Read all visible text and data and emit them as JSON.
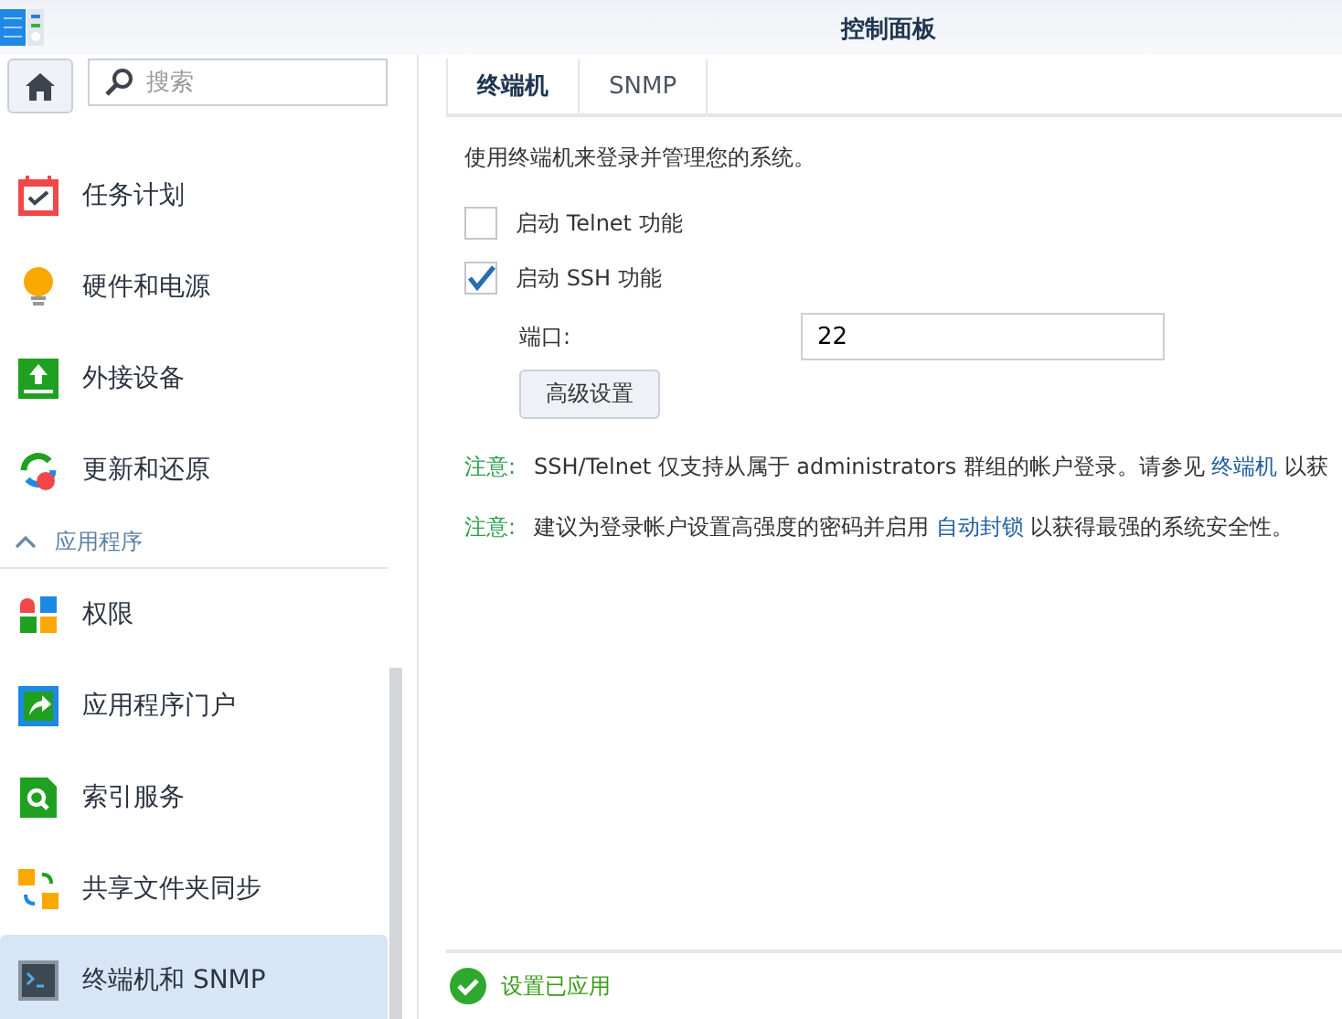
{
  "window": {
    "title": "控制面板"
  },
  "search": {
    "placeholder": "搜索"
  },
  "sidebar": {
    "items": [
      {
        "kind": "item",
        "label": "任务计划",
        "selected": false
      },
      {
        "kind": "item",
        "label": "硬件和电源",
        "selected": false
      },
      {
        "kind": "item",
        "label": "外接设备",
        "selected": false
      },
      {
        "kind": "item",
        "label": "更新和还原",
        "selected": false
      },
      {
        "kind": "section",
        "label": "应用程序",
        "expanded": true
      },
      {
        "kind": "item",
        "label": "权限",
        "selected": false
      },
      {
        "kind": "item",
        "label": "应用程序门户",
        "selected": false
      },
      {
        "kind": "item",
        "label": "索引服务",
        "selected": false
      },
      {
        "kind": "item",
        "label": "共享文件夹同步",
        "selected": false
      },
      {
        "kind": "item",
        "label": "终端机和 SNMP",
        "selected": true
      }
    ]
  },
  "tabs": [
    {
      "label": "终端机",
      "selected": true
    },
    {
      "label": "SNMP",
      "selected": false
    }
  ],
  "description": "使用终端机来登录并管理您的系统。",
  "options": [
    {
      "label": "启动 Telnet 功能",
      "checked": false
    },
    {
      "label": "启动 SSH 功能",
      "checked": true
    }
  ],
  "port": {
    "label": "端口:",
    "value": "22"
  },
  "advanced_button": "高级设置",
  "notes": [
    {
      "label": "注意:",
      "parts": [
        {
          "kind": "text",
          "text": "SSH/Telnet 仅支持从属于 administrators 群组的帐户登录。请参见 "
        },
        {
          "kind": "link",
          "text": "终端机"
        },
        {
          "kind": "text",
          "text": " 以获"
        }
      ]
    },
    {
      "label": "注意:",
      "parts": [
        {
          "kind": "text",
          "text": "建议为登录帐户设置高强度的密码并启用 "
        },
        {
          "kind": "link",
          "text": "自动封锁"
        },
        {
          "kind": "text",
          "text": " 以获得最强的系统安全性。"
        }
      ]
    }
  ],
  "status": {
    "text": "设置已应用"
  }
}
